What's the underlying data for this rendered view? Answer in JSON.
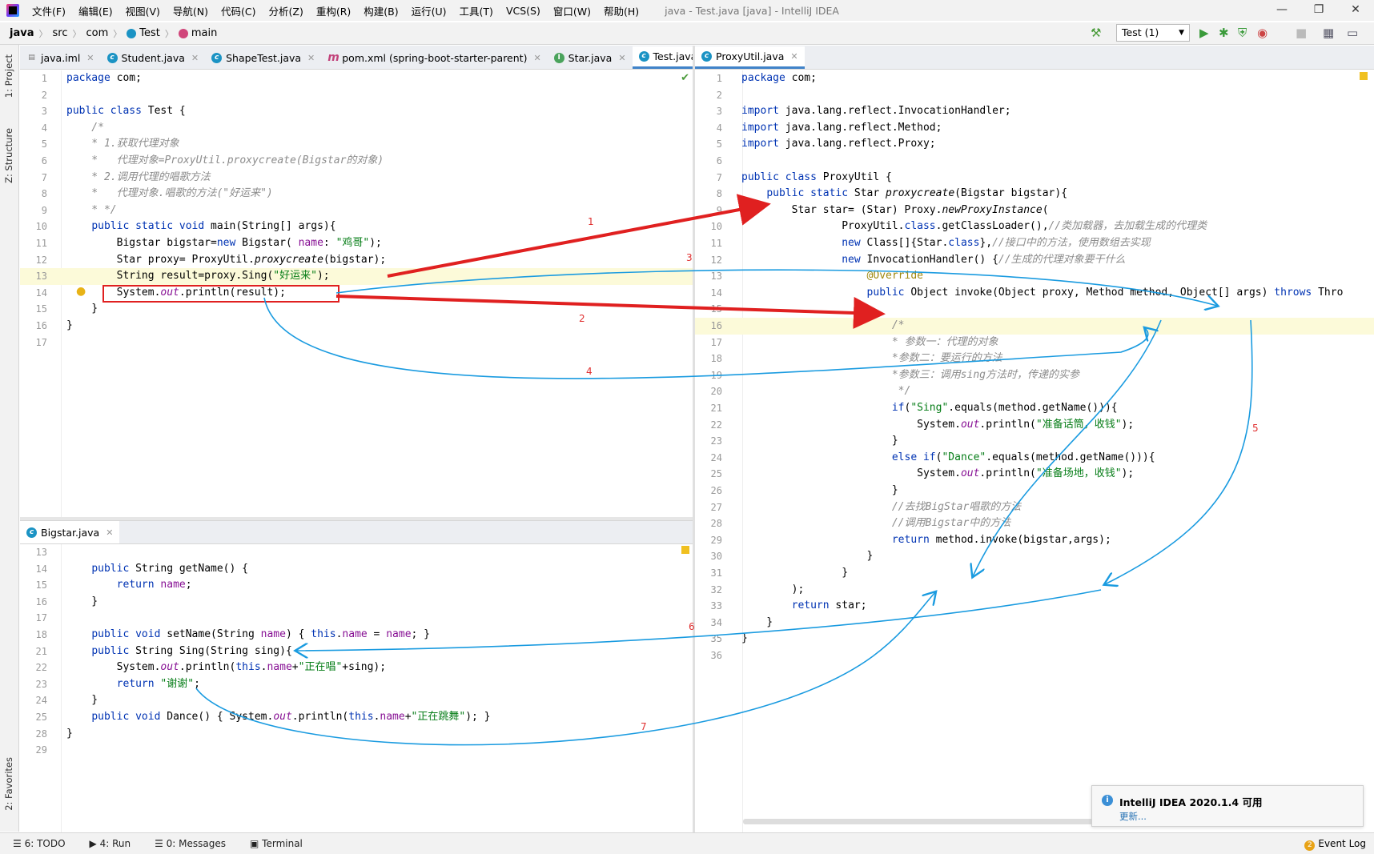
{
  "window": {
    "menus": [
      "文件(F)",
      "编辑(E)",
      "视图(V)",
      "导航(N)",
      "代码(C)",
      "分析(Z)",
      "重构(R)",
      "构建(B)",
      "运行(U)",
      "工具(T)",
      "VCS(S)",
      "窗口(W)",
      "帮助(H)"
    ],
    "title": "java - Test.java [java] - IntelliJ IDEA"
  },
  "breadcrumb": [
    "java",
    "src",
    "com",
    "Test",
    "main"
  ],
  "run_config": "Test (1)",
  "tool_windows": {
    "project": "1: Project",
    "structure": "Z: Structure",
    "favorites": "2: Favorites"
  },
  "left_tabs": [
    {
      "label": "java.iml",
      "icon": "module-file-icon"
    },
    {
      "label": "Student.java",
      "icon": "class-icon"
    },
    {
      "label": "ShapeTest.java",
      "icon": "class-icon"
    },
    {
      "label": "pom.xml (spring-boot-starter-parent)",
      "icon": "maven-icon"
    },
    {
      "label": "Star.java",
      "icon": "interface-icon"
    },
    {
      "label": "Test.java",
      "icon": "class-icon",
      "active": true
    }
  ],
  "right_tab": "ProxyUtil.java",
  "bottom_tab": "Bigstar.java",
  "test_code": [
    {
      "n": "1",
      "t": "package com;"
    },
    {
      "n": "2",
      "t": ""
    },
    {
      "n": "3",
      "t": "public class Test {"
    },
    {
      "n": "4",
      "t": "    /*"
    },
    {
      "n": "5",
      "t": "    * 1.获取代理对象"
    },
    {
      "n": "6",
      "t": "    *   代理对象=ProxyUtil.proxycreate(Bigstar的对象)"
    },
    {
      "n": "7",
      "t": "    * 2.调用代理的唱歌方法"
    },
    {
      "n": "8",
      "t": "    *   代理对象.唱歌的方法(\"好运来\")"
    },
    {
      "n": "9",
      "t": "    * */"
    },
    {
      "n": "10",
      "t": "    public static void main(String[] args){"
    },
    {
      "n": "11",
      "t": "        Bigstar bigstar=new Bigstar( name: \"鸡哥\");"
    },
    {
      "n": "12",
      "t": "        Star proxy= ProxyUtil.proxycreate(bigstar);"
    },
    {
      "n": "13",
      "t": "        String result=proxy.Sing(\"好运来\");"
    },
    {
      "n": "14",
      "t": "        System.out.println(result);"
    },
    {
      "n": "15",
      "t": "    }"
    },
    {
      "n": "16",
      "t": "}"
    },
    {
      "n": "17",
      "t": ""
    }
  ],
  "proxy_code": [
    {
      "n": "1",
      "t": "package com;"
    },
    {
      "n": "2",
      "t": ""
    },
    {
      "n": "3",
      "t": "import java.lang.reflect.InvocationHandler;"
    },
    {
      "n": "4",
      "t": "import java.lang.reflect.Method;"
    },
    {
      "n": "5",
      "t": "import java.lang.reflect.Proxy;"
    },
    {
      "n": "6",
      "t": ""
    },
    {
      "n": "7",
      "t": "public class ProxyUtil {"
    },
    {
      "n": "8",
      "t": "    public static Star proxycreate(Bigstar bigstar){"
    },
    {
      "n": "9",
      "t": "        Star star= (Star) Proxy.newProxyInstance("
    },
    {
      "n": "10",
      "t": "                ProxyUtil.class.getClassLoader(),//类加载器，去加载生成的代理类"
    },
    {
      "n": "11",
      "t": "                new Class[]{Star.class},//接口中的方法，使用数组去实现"
    },
    {
      "n": "12",
      "t": "                new InvocationHandler() {//生成的代理对象要干什么"
    },
    {
      "n": "13",
      "t": "                    @Override"
    },
    {
      "n": "14",
      "t": "                    public Object invoke(Object proxy, Method method, Object[] args) throws Thro"
    },
    {
      "n": "15",
      "t": ""
    },
    {
      "n": "16",
      "t": "                        /*"
    },
    {
      "n": "17",
      "t": "                        * 参数一：代理的对象"
    },
    {
      "n": "18",
      "t": "                        *参数二：要运行的方法"
    },
    {
      "n": "19",
      "t": "                        *参数三：调用sing方法时，传递的实参"
    },
    {
      "n": "20",
      "t": "                         */"
    },
    {
      "n": "21",
      "t": "                        if(\"Sing\".equals(method.getName())){"
    },
    {
      "n": "22",
      "t": "                            System.out.println(\"准备话筒，收钱\");"
    },
    {
      "n": "23",
      "t": "                        }"
    },
    {
      "n": "24",
      "t": "                        else if(\"Dance\".equals(method.getName())){"
    },
    {
      "n": "25",
      "t": "                            System.out.println(\"准备场地，收钱\");"
    },
    {
      "n": "26",
      "t": "                        }"
    },
    {
      "n": "27",
      "t": "                        //去找BigStar唱歌的方法"
    },
    {
      "n": "28",
      "t": "                        //调用Bigstar中的方法"
    },
    {
      "n": "29",
      "t": "                        return method.invoke(bigstar,args);"
    },
    {
      "n": "30",
      "t": "                    }"
    },
    {
      "n": "31",
      "t": "                }"
    },
    {
      "n": "32",
      "t": "        );"
    },
    {
      "n": "33",
      "t": "        return star;"
    },
    {
      "n": "34",
      "t": "    }"
    },
    {
      "n": "35",
      "t": "}"
    },
    {
      "n": "36",
      "t": ""
    }
  ],
  "bigstar_code": [
    {
      "n": "13",
      "t": ""
    },
    {
      "n": "14",
      "t": "    public String getName() {"
    },
    {
      "n": "15",
      "t": "        return name;"
    },
    {
      "n": "16",
      "t": "    }"
    },
    {
      "n": "17",
      "t": ""
    },
    {
      "n": "18",
      "t": "    public void setName(String name) { this.name = name; }"
    },
    {
      "n": "21",
      "t": "    public String Sing(String sing){"
    },
    {
      "n": "22",
      "t": "        System.out.println(this.name+\"正在唱\"+sing);"
    },
    {
      "n": "23",
      "t": "        return \"谢谢\";"
    },
    {
      "n": "24",
      "t": "    }"
    },
    {
      "n": "25",
      "t": "    public void Dance() { System.out.println(this.name+\"正在跳舞\"); }"
    },
    {
      "n": "28",
      "t": "}"
    },
    {
      "n": "29",
      "t": ""
    }
  ],
  "annotations": [
    "1",
    "2",
    "3",
    "4",
    "5",
    "6",
    "7"
  ],
  "bottom_tools": [
    "6: TODO",
    "4: Run",
    "0: Messages",
    "Terminal"
  ],
  "event_log": {
    "count": "2",
    "label": "Event Log"
  },
  "notification": {
    "title": "IntelliJ IDEA 2020.1.4 可用",
    "link": "更新..."
  },
  "colors": {
    "accent": "#4083c9",
    "arrow_red": "#e02020",
    "arrow_blue": "#1a9be0"
  }
}
